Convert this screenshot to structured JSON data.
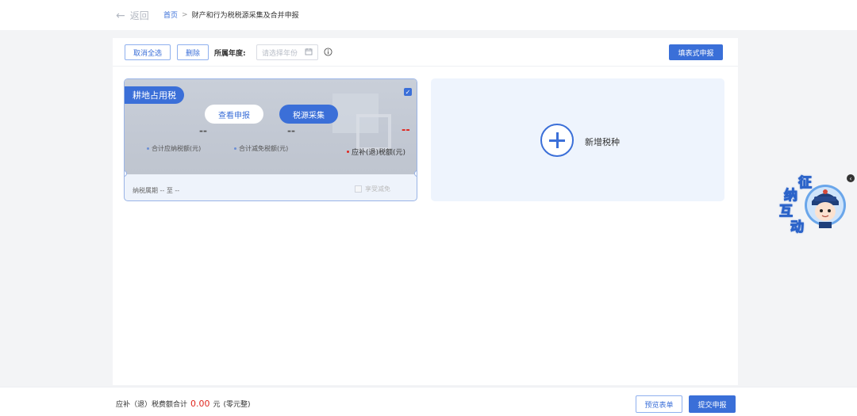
{
  "nav": {
    "back_label": "返回",
    "breadcrumb_home": "首页",
    "breadcrumb_sep": ">",
    "breadcrumb_current": "财产和行为税税源采集及合并申报"
  },
  "toolbar": {
    "deselect_all": "取消全选",
    "delete": "删除",
    "year_label": "所属年度:",
    "year_placeholder": "请选择年份",
    "fill_form": "填表式申报"
  },
  "tax_card": {
    "tag": "耕地占用税",
    "view_declaration": "查看申报",
    "source_collection": "税源采集",
    "total_payable_value": "--",
    "total_payable_label": "合计应纳税额(元)",
    "total_relief_value": "--",
    "total_relief_label": "合计减免税额(元)",
    "refund_value": "--",
    "refund_label": "应补(退)税额(元)",
    "period_label": "纳税属期 -- 至 --",
    "preferential_label": "享受减免",
    "checked_mark": "✓"
  },
  "add_card": {
    "label": "新增税种"
  },
  "footer": {
    "total_prefix": "应补（退）税费额合计",
    "total_amount": "0.00",
    "total_unit": "元",
    "total_words": "(零元整)",
    "preview": "预览表单",
    "submit": "提交申报"
  },
  "assistant": {
    "chars": [
      "征",
      "纳",
      "互",
      "动"
    ]
  },
  "colors": {
    "primary": "#3a6fd8",
    "danger": "#e0261e",
    "card_bg": "#eef4fd"
  }
}
